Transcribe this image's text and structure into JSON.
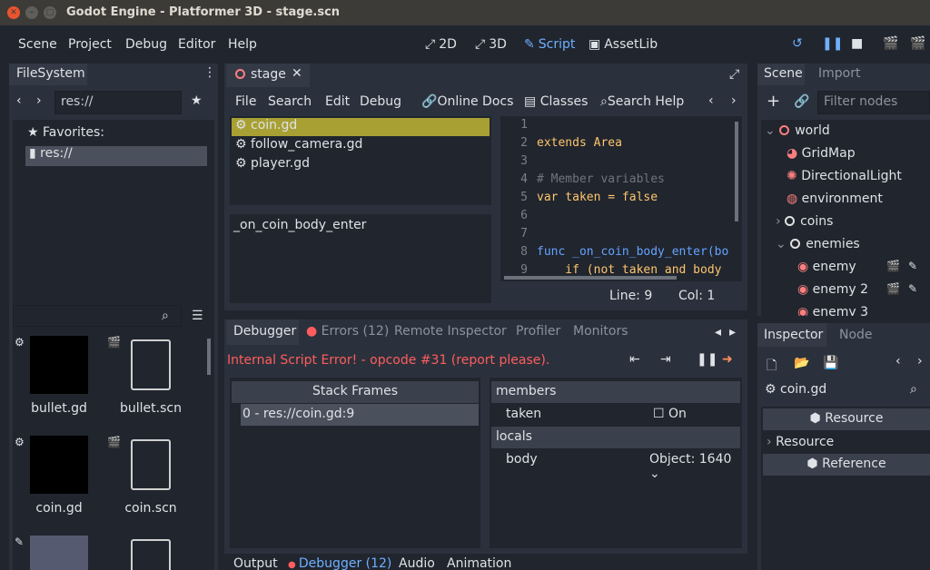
{
  "window": {
    "title": "Godot Engine - Platformer 3D - stage.scn"
  },
  "menu": {
    "items": [
      "Scene",
      "Project",
      "Debug",
      "Editor",
      "Help"
    ]
  },
  "workspaces": [
    {
      "label": "2D",
      "icon": "⤡"
    },
    {
      "label": "3D",
      "icon": "⤡"
    },
    {
      "label": "Script",
      "icon": "✎"
    },
    {
      "label": "AssetLib",
      "icon": "🛍"
    }
  ],
  "filesystem": {
    "tab": "FileSystem",
    "path": "res://",
    "favorites_label": "Favorites:",
    "root_label": "res://",
    "files": [
      {
        "name": "bullet.gd"
      },
      {
        "name": "bullet.scn"
      },
      {
        "name": "coin.gd"
      },
      {
        "name": "coin.scn"
      }
    ]
  },
  "script_editor": {
    "tab": "stage",
    "menu": [
      "File",
      "Search",
      "Edit",
      "Debug",
      "Online Docs",
      "Classes",
      "Search Help"
    ],
    "script_files": [
      "coin.gd",
      "follow_camera.gd",
      "player.gd"
    ],
    "methods": [
      "_on_coin_body_enter"
    ],
    "code": {
      "line_numbers": [
        "1",
        "2",
        "3",
        "4",
        "5",
        "6",
        "7",
        "8",
        "9"
      ],
      "lines": [
        "",
        "extends Area",
        "",
        "# Member variables",
        "var taken = false",
        "",
        "",
        "func _on_coin_body_enter(bo",
        "    if (not taken and body"
      ]
    },
    "status": {
      "line": "Line: 9",
      "col": "Col: 1"
    }
  },
  "debugger": {
    "tabs": [
      "Debugger",
      "Errors (12)",
      "Remote Inspector",
      "Profiler",
      "Monitors"
    ],
    "error": "Internal Script Error! - opcode #31 (report please).",
    "stack_header": "Stack Frames",
    "stack_frames": [
      "0 - res://coin.gd:9"
    ],
    "members_header": "members",
    "member_name": "taken",
    "member_value": "On",
    "locals_header": "locals",
    "local_name": "body",
    "local_value": "Object: 1640"
  },
  "bottom_tabs": [
    "Output",
    "Debugger (12)",
    "Audio",
    "Animation"
  ],
  "scene": {
    "tabs": [
      "Scene",
      "Import"
    ],
    "filter_placeholder": "Filter nodes",
    "nodes": [
      "world",
      "GridMap",
      "DirectionalLight",
      "environment",
      "coins",
      "enemies",
      "enemy",
      "enemy 2",
      "enemy 3"
    ]
  },
  "inspector": {
    "tabs": [
      "Inspector",
      "Node"
    ],
    "object": "coin.gd",
    "rows": [
      "Resource",
      "Resource",
      "Reference"
    ]
  },
  "colors": {
    "accent": "#6fb0ff",
    "error": "#ff5d5d",
    "highlight": "#a8a033"
  }
}
